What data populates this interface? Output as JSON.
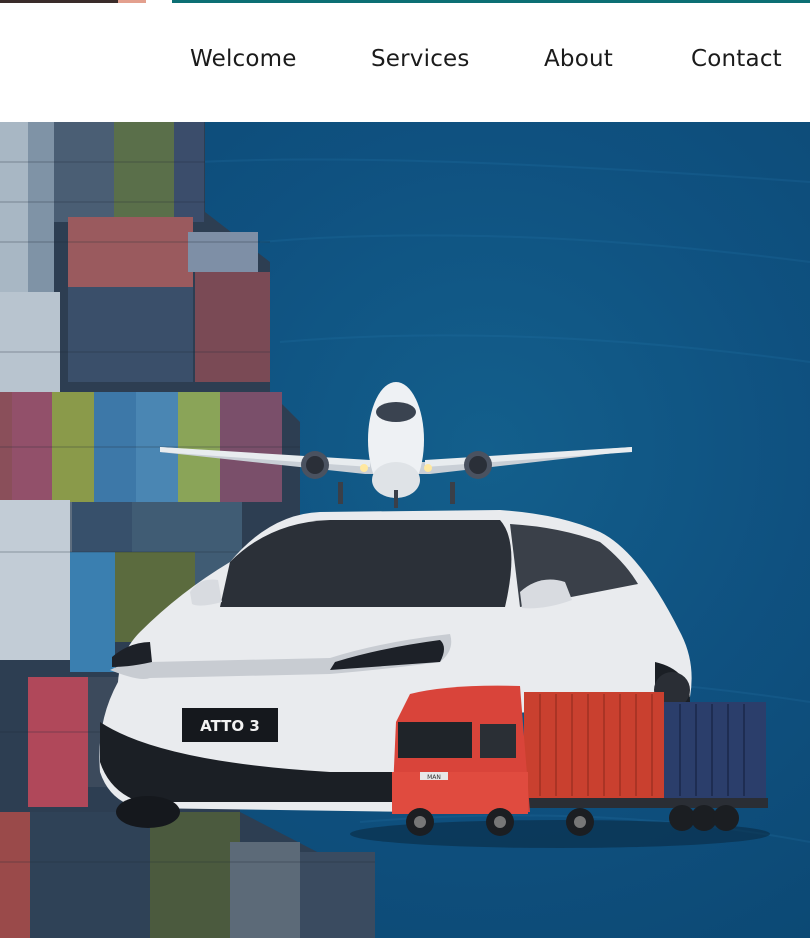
{
  "nav": {
    "items": [
      {
        "label": "Welcome"
      },
      {
        "label": "Services"
      },
      {
        "label": "About"
      },
      {
        "label": "Contact"
      }
    ]
  },
  "hero": {
    "car_badge": "ATTO 3",
    "truck_badge": "MAN"
  },
  "colors": {
    "sea": "#0f5180",
    "accent_strip": "#0c6f74",
    "truck_cab": "#d9443a",
    "container_red": "#c9402f",
    "container_blue": "#2b3e6b"
  }
}
